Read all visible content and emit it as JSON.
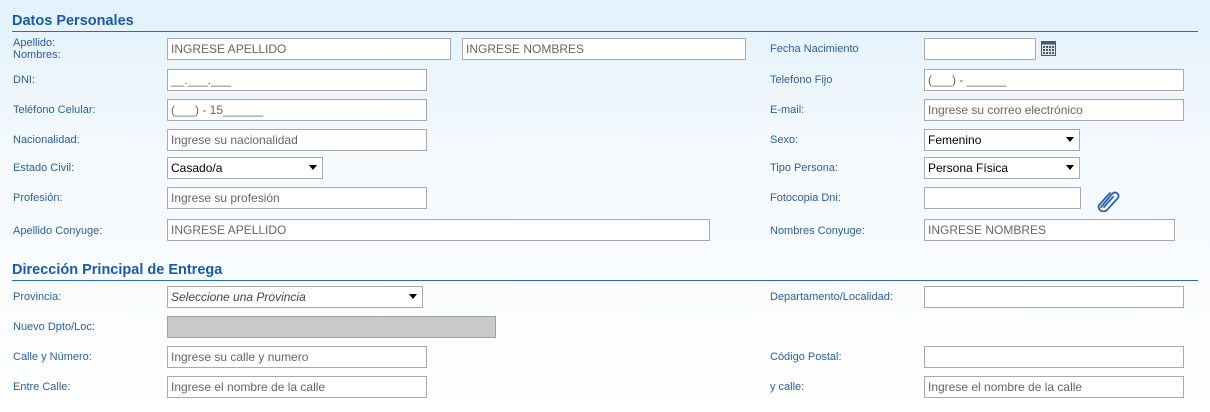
{
  "personal": {
    "title": "Datos Personales",
    "apellido_nombres_label": "Apellido:\nNombres:",
    "apellido_placeholder": "INGRESE APELLIDO",
    "nombres_placeholder": "INGRESE NOMBRES",
    "fecha_label": "Fecha Nacimiento",
    "fecha_value": "",
    "dni_label": "DNI:",
    "dni_mask": "__.___.___",
    "telefono_fijo_label": "Telefono Fijo",
    "telefono_fijo_mask": "(___) - ______",
    "celular_label": "Teléfono Celular:",
    "celular_mask": "(___) - 15______",
    "email_label": "E-mail:",
    "email_placeholder": "Ingrese su correo electrónico",
    "nacionalidad_label": "Nacionalidad:",
    "nacionalidad_placeholder": "Ingrese su nacionalidad",
    "sexo_label": "Sexo:",
    "sexo_value": "Femenino",
    "estado_civil_label": "Estado Civil:",
    "estado_civil_value": "Casado/a",
    "tipo_persona_label": "Tipo Persona:",
    "tipo_persona_value": "Persona Física",
    "profesion_label": "Profesión:",
    "profesion_placeholder": "Ingrese su profesión",
    "fotocopia_label": "Fotocopia Dni:",
    "fotocopia_value": "",
    "apellido_conyuge_label": "Apellido Conyuge:",
    "apellido_conyuge_placeholder": "INGRESE APELLIDO",
    "nombres_conyuge_label": "Nombres Conyuge:",
    "nombres_conyuge_placeholder": "INGRESE NOMBRES"
  },
  "address": {
    "title": "Dirección Principal de Entrega",
    "provincia_label": "Provincia:",
    "provincia_value": "Seleccione una Provincia",
    "departamento_label": "Departamento/Localidad:",
    "departamento_value": "",
    "nuevo_label": "Nuevo Dpto/Loc:",
    "nuevo_value": "",
    "calle_label": "Calle y Número:",
    "calle_placeholder": "Ingrese su calle y numero",
    "codigo_postal_label": "Código Postal:",
    "codigo_postal_value": "",
    "entre_calle_label": "Entre Calle:",
    "entre_calle_placeholder": "Ingrese el nombre de la calle",
    "y_calle_label": "y calle:",
    "y_calle_placeholder": "Ingrese el nombre de la calle"
  },
  "icons": {
    "calendar": "calendar-icon",
    "attach": "paperclip-icon"
  },
  "colors": {
    "label": "#2a5fa0",
    "section_title": "#1a5aa6",
    "field_border": "#a9a9a9",
    "disabled_field": "#c9c9c9"
  }
}
